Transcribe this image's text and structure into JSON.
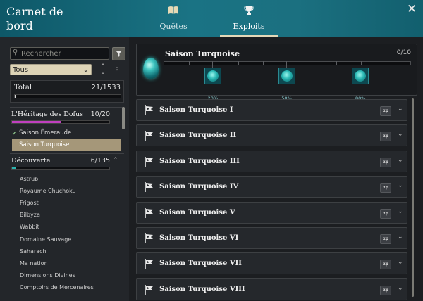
{
  "window": {
    "title": "Carnet de bord",
    "close_icon": "close-icon"
  },
  "tabs": [
    {
      "label": "Quêtes",
      "icon": "book-icon",
      "active": false
    },
    {
      "label": "Exploits",
      "icon": "trophy-icon",
      "active": true
    }
  ],
  "sidebar": {
    "search_placeholder": "Rechercher",
    "filter_icon": "filter-icon",
    "select_value": "Tous",
    "total": {
      "label": "Total",
      "count": "21/1533",
      "progress": 0.0137
    },
    "categories": [
      {
        "label": "L'Héritage des Dofus",
        "count": "10/20",
        "progress": 0.5,
        "color": "#c040c0",
        "expanded": true,
        "subitems": [
          {
            "label": "Saison Émeraude",
            "checked": true,
            "selected": false
          },
          {
            "label": "Saison Turquoise",
            "checked": false,
            "selected": true
          }
        ]
      },
      {
        "label": "Découverte",
        "count": "6/135",
        "progress": 0.044,
        "color": "#2bb5b0",
        "expanded": true,
        "items": [
          "Astrub",
          "Royaume Chuchoku",
          "Frigost",
          "Bilbyza",
          "Wabbit",
          "Domaine Sauvage",
          "Saharach",
          "Ma nation",
          "Dimensions Divines",
          "Comptoirs de Mercenaires"
        ]
      }
    ]
  },
  "summary": {
    "name": "Saison Turquoise",
    "count": "0/10",
    "progress": 0,
    "milestones": [
      "20%",
      "50%",
      "80%"
    ]
  },
  "achievements": {
    "xp_label": "xp",
    "rows": [
      "Saison Turquoise I",
      "Saison Turquoise II",
      "Saison Turquoise III",
      "Saison Turquoise IV",
      "Saison Turquoise V",
      "Saison Turquoise VI",
      "Saison Turquoise VII",
      "Saison Turquoise VIII"
    ]
  },
  "colors": {
    "header": "#1a7384",
    "accent": "#ddd4b7",
    "turquoise": "#2bb5b0",
    "heritage": "#c040c0"
  }
}
